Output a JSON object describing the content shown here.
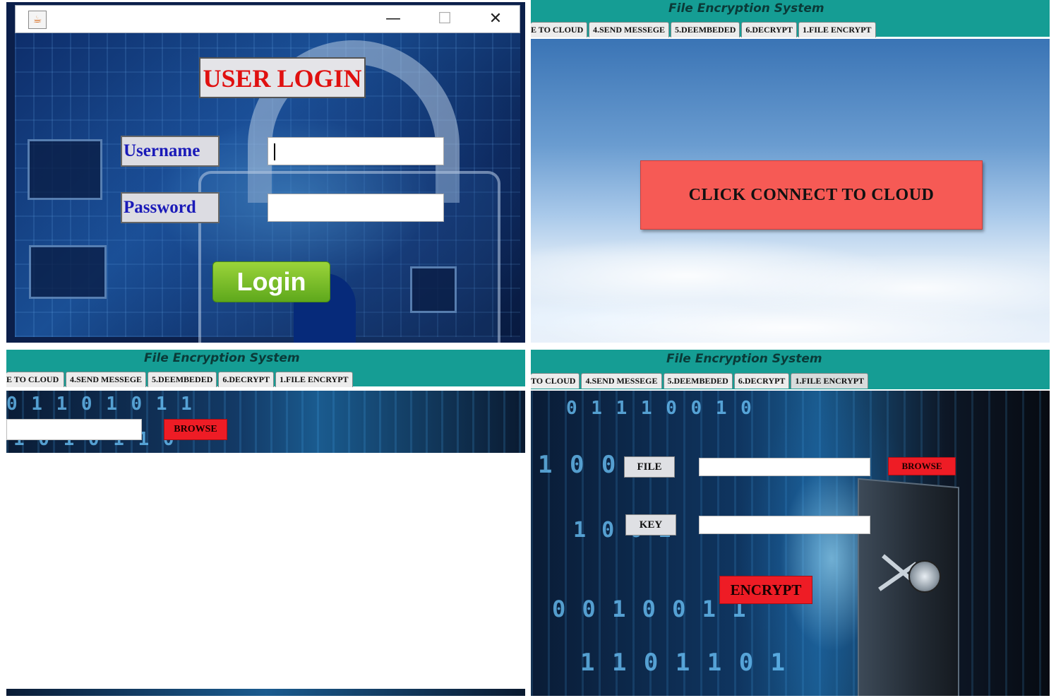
{
  "login": {
    "title": "USER LOGIN",
    "username_label": "Username",
    "password_label": "Password",
    "username_value": "",
    "password_value": "",
    "login_button": "Login",
    "window_controls": {
      "minimize": "—",
      "maximize": "☐",
      "close": "✕"
    },
    "window_icon": "java-icon"
  },
  "app": {
    "title": "File Encryption System",
    "tabs_panel2": [
      "E TO CLOUD",
      "4.SEND MESSEGE",
      "5.DEEMBEDED",
      "6.DECRYPT",
      "1.FILE ENCRYPT"
    ],
    "tabs_panel3": [
      "E TO CLOUD",
      "4.SEND MESSEGE",
      "5.DEEMBEDED",
      "6.DECRYPT",
      "1.FILE ENCRYPT"
    ],
    "tabs_panel4": [
      "TO CLOUD",
      "4.SEND MESSEGE",
      "5.DEEMBEDED",
      "6.DECRYPT",
      "1.FILE ENCRYPT"
    ]
  },
  "cloud": {
    "connect_button": "CLICK CONNECT TO CLOUD"
  },
  "encrypt": {
    "browse_button": "BROWSE",
    "file_label": "FILE",
    "key_label": "KEY",
    "file_value": "",
    "key_value": "",
    "encrypt_button": "ENCRYPT"
  },
  "colors": {
    "header_teal": "#159d94",
    "red_button": "#ee1c25",
    "cloud_button": "#f65a55",
    "login_green": "#6db522",
    "login_title_red": "#e01010",
    "label_blue": "#1a1ab8"
  }
}
